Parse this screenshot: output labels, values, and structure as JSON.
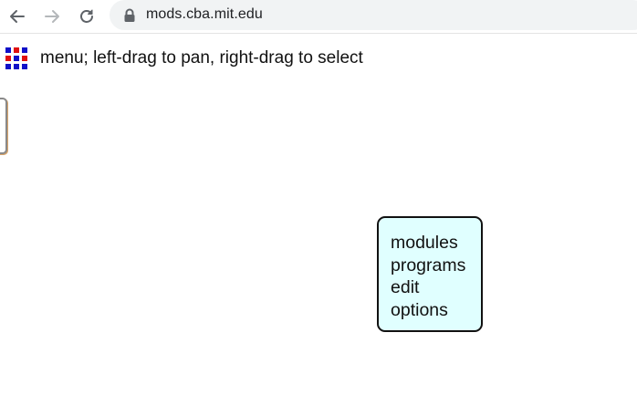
{
  "browser": {
    "address_url": "mods.cba.mit.edu",
    "back_icon": "arrow-left-icon",
    "forward_icon": "arrow-right-icon",
    "reload_icon": "reload-icon",
    "lock_icon": "lock-icon"
  },
  "page": {
    "logo_icon": "mods-grid-logo-icon",
    "hint": "menu; left-drag to pan, right-drag to select"
  },
  "menu": {
    "items": [
      {
        "label": "modules"
      },
      {
        "label": "programs"
      },
      {
        "label": "edit"
      },
      {
        "label": "options"
      }
    ],
    "background_color": "#e0ffff",
    "border_color": "#111111"
  },
  "colors": {
    "logo_red": "#e01010",
    "logo_blue": "#1010c8",
    "toolbar_background": "#ffffff",
    "omnibox_background": "#f1f3f4"
  }
}
